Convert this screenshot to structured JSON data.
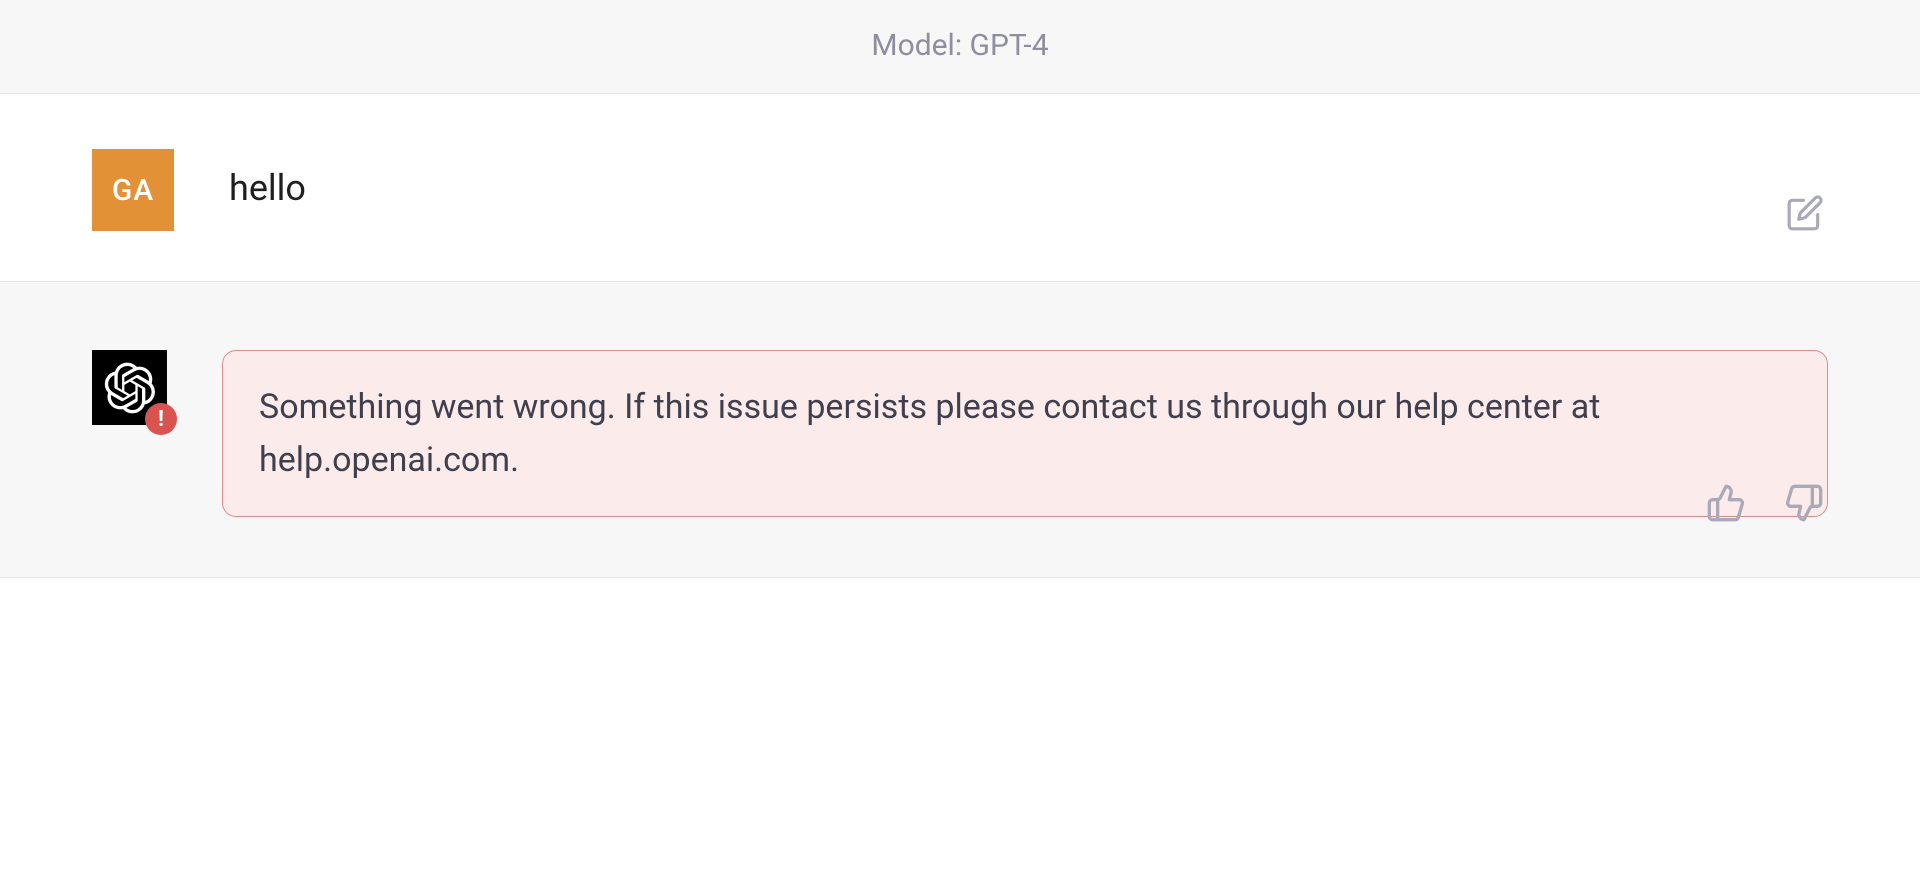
{
  "header": {
    "model_label": "Model: GPT-4"
  },
  "user": {
    "avatar_initials": "GA",
    "message": "hello"
  },
  "assistant": {
    "error_message": "Something went wrong. If this issue persists please contact us through our help center at help.openai.com.",
    "error_badge": "!"
  },
  "icons": {
    "edit": "edit-icon",
    "openai_logo": "openai-logo-icon",
    "thumbs_up": "thumbs-up-icon",
    "thumbs_down": "thumbs-down-icon"
  }
}
